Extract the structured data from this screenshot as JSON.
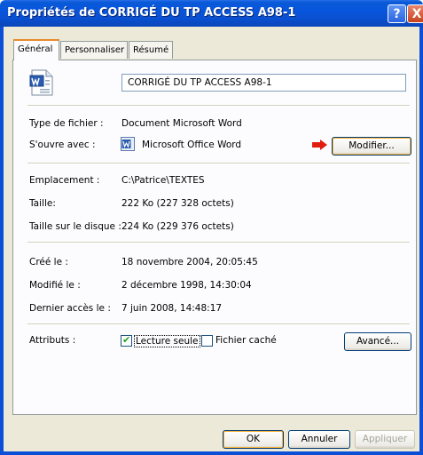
{
  "window": {
    "title": "Propriétés de CORRIGÉ DU TP ACCESS A98-1",
    "help": "?",
    "close": "X"
  },
  "tabs": [
    "Général",
    "Personnaliser",
    "Résumé"
  ],
  "file_name": "CORRIGÉ DU TP ACCESS A98-1",
  "file_info": {
    "type_label": "Type de fichier :",
    "type_value": "Document Microsoft Word",
    "opens_label": "S'ouvre avec :",
    "opens_value": "Microsoft Office Word",
    "change_button": "Modifier..."
  },
  "location": {
    "location_label": "Emplacement :",
    "location_value": "C:\\Patrice\\TEXTES",
    "size_label": "Taille:",
    "size_value": "222 Ko (227 328 octets)",
    "disk_label": "Taille sur le disque :",
    "disk_value": "224 Ko (229 376 octets)"
  },
  "dates": {
    "created_label": "Créé le :",
    "created_value": "18 novembre 2004, 20:05:45",
    "modified_label": "Modifié le :",
    "modified_value": "2 décembre 1998, 14:30:04",
    "accessed_label": "Dernier accès le :",
    "accessed_value": "7 juin 2008, 14:48:17"
  },
  "attributes": {
    "label": "Attributs :",
    "readonly_label": "Lecture seule",
    "readonly_checked": true,
    "hidden_label": "Fichier caché",
    "hidden_checked": false,
    "advanced_button": "Avancé..."
  },
  "buttons": {
    "ok": "OK",
    "cancel": "Annuler",
    "apply": "Appliquer"
  },
  "colors": {
    "title_bar": "#0855dd",
    "dialog_bg": "#ece9d8",
    "panel_bg": "#fcfcfe",
    "arrow": "#e11d0e"
  }
}
